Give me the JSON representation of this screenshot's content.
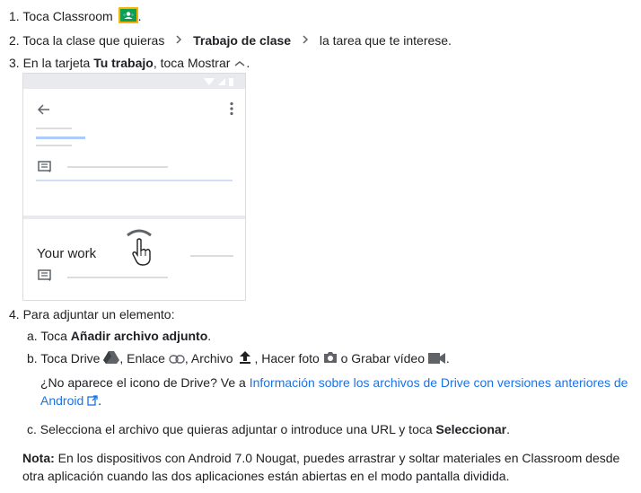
{
  "steps": {
    "s1_num": "1.",
    "s1_text": "Toca Classroom",
    "s1_end": ".",
    "s2_num": "2.",
    "s2_a": "Toca la clase que quieras",
    "s2_b": "Trabajo de clase",
    "s2_c": "la tarea que te interese.",
    "s3_num": "3.",
    "s3_a": "En la tarjeta",
    "s3_b": "Tu trabajo",
    "s3_c": ", toca Mostrar",
    "s3_end": ".",
    "s4_num": "4.",
    "s4_text": "Para adjuntar un elemento:",
    "a_num": "a.",
    "a_pre": "Toca",
    "a_bold": "Añadir archivo adjunto",
    "a_end": ".",
    "b_num": "b.",
    "b_drive": "Toca Drive",
    "b_link": ", Enlace",
    "b_file": ", Archivo",
    "b_photo": ", Hacer foto",
    "b_video": "o Grabar vídeo",
    "b_end": ".",
    "b_note1": "¿No aparece el icono de Drive? Ve a",
    "b_link1": "Información sobre los archivos de Drive con versiones anteriores de",
    "b_link2": "Android",
    "b_end2": ".",
    "c_num": "c.",
    "c_pre": "Selecciona el archivo que quieras adjuntar o introduce una URL y toca",
    "c_bold": "Seleccionar",
    "c_end": "."
  },
  "phone": {
    "your_work": "Your work"
  },
  "note": {
    "label": "Nota:",
    "line1": "En los dispositivos con Android 7.0 Nougat, puedes arrastrar y soltar materiales en Classroom desde",
    "line2": "otra aplicación cuando las dos aplicaciones están abiertas en el modo pantalla dividida."
  },
  "colors": {
    "link": "#1a73e8",
    "classroom_green": "#0f9d58",
    "classroom_yellow": "#f4b400"
  },
  "icons": [
    "classroom-icon",
    "chevron-right-icon",
    "chevron-up-icon",
    "back-arrow-icon",
    "more-vert-icon",
    "comment-icon",
    "hand-pointer-icon",
    "drive-icon",
    "link-icon",
    "upload-icon",
    "camera-icon",
    "videocam-icon",
    "external-link-icon"
  ]
}
